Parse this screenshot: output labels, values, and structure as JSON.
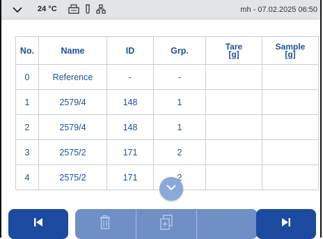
{
  "status": {
    "temperature": "24 °C",
    "user_datetime": "mh - 07.02.2025 06:50"
  },
  "table": {
    "headers": {
      "no": "No.",
      "name": "Name",
      "id": "ID",
      "grp": "Grp.",
      "tare": "Tare",
      "tare_unit": "[g]",
      "sample": "Sample",
      "sample_unit": "[g]"
    },
    "rows": [
      {
        "no": "0",
        "name": "Reference",
        "id": "-",
        "grp": "-",
        "tare": "",
        "sample": ""
      },
      {
        "no": "1",
        "name": "2579/4",
        "id": "148",
        "grp": "1",
        "tare": "",
        "sample": ""
      },
      {
        "no": "2",
        "name": "2579/4",
        "id": "148",
        "grp": "1",
        "tare": "",
        "sample": ""
      },
      {
        "no": "3",
        "name": "2575/2",
        "id": "171",
        "grp": "2",
        "tare": "",
        "sample": ""
      },
      {
        "no": "4",
        "name": "2575/2",
        "id": "171",
        "grp": "2",
        "tare": "",
        "sample": ""
      }
    ]
  },
  "icons": {
    "status_menu": "chevron-down-icon",
    "status_printer": "printer-icon",
    "status_tube": "test-tube-icon",
    "status_network": "network-icon",
    "scroll": "chevron-down-icon",
    "first": "skip-first-icon",
    "delete": "trash-icon",
    "copy": "copy-icon",
    "last": "skip-last-icon"
  },
  "colors": {
    "primary_button": "#1b4aa0",
    "disabled_button": "#6f8fc6",
    "table_text": "#1d4f99",
    "status_bar": "#e3e4e7"
  }
}
